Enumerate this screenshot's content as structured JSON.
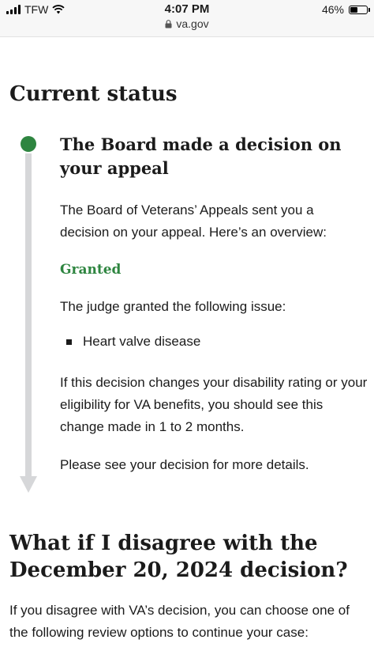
{
  "status_bar": {
    "carrier": "TFW",
    "time": "4:07 PM",
    "url": "va.gov",
    "battery_percent_label": "46%",
    "battery_level": 0.46
  },
  "status_section": {
    "heading": "Current status",
    "event_title": "The Board made a decision on your appeal",
    "intro": "The Board of Veterans’ Appeals sent you a decision on your appeal. Here’s an overview:",
    "outcome_label": "Granted",
    "granted_intro": "The judge granted the following issue:",
    "issues": [
      "Heart valve disease"
    ],
    "rating_note": "If this decision changes your disability rating or your eligibility for VA benefits, you should see this change made in 1 to 2 months.",
    "details_note": "Please see your decision for more details."
  },
  "disagree_section": {
    "heading": "What if I disagree with the December 20, 2024 decision?",
    "text": "If you disagree with VA’s decision, you can choose one of the following review options to continue your case:"
  },
  "colors": {
    "granted_green": "#2e8540",
    "timeline_gray": "#d6d7d9",
    "text": "#1b1b1b"
  }
}
